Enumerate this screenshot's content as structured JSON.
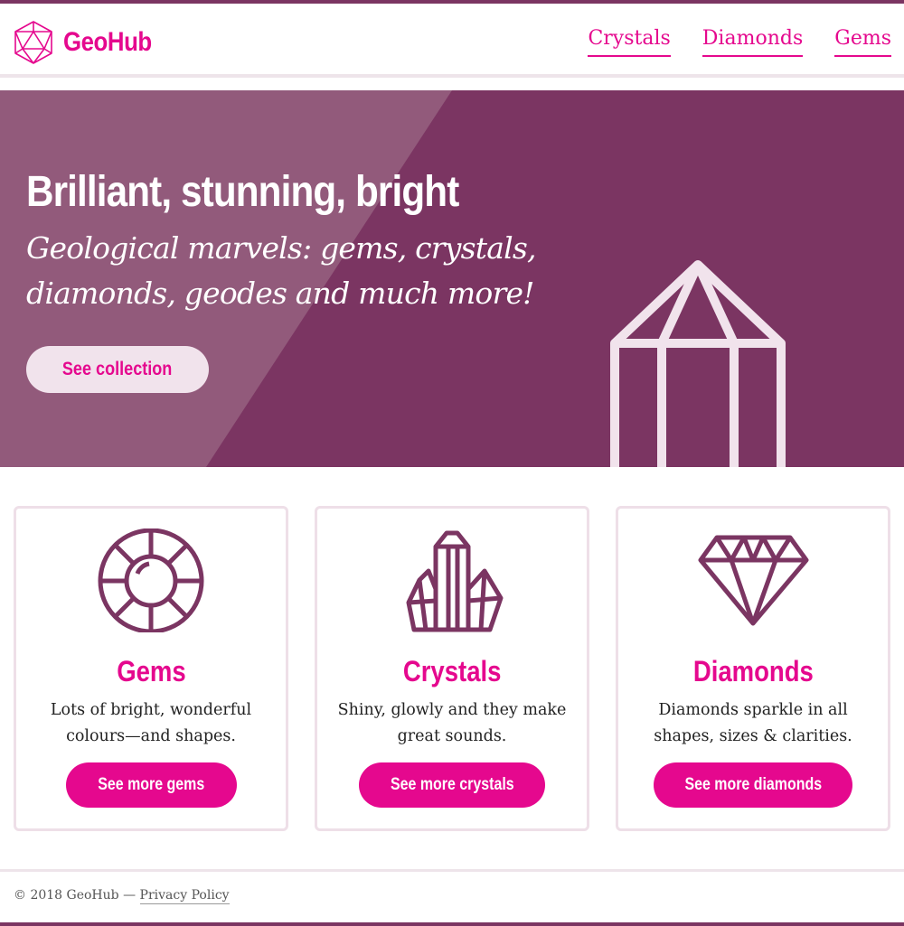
{
  "header": {
    "logo_text": "GeoHub",
    "logo_icon": "icosahedron-icon",
    "nav": [
      {
        "label": "Crystals"
      },
      {
        "label": "Diamonds"
      },
      {
        "label": "Gems"
      }
    ]
  },
  "hero": {
    "title": "Brilliant, stunning, bright",
    "subtitle": "Geological marvels: gems, crystals, diamonds, geodes and much more!",
    "button_label": "See collection",
    "illustration": "crystal-outline-icon"
  },
  "cards": [
    {
      "icon": "gem-icon",
      "title": "Gems",
      "text": "Lots of bright, wonderful colours—and shapes.",
      "button_label": "See more gems"
    },
    {
      "icon": "crystals-icon",
      "title": "Crystals",
      "text": "Shiny, glowly and they make great sounds.",
      "button_label": "See more crystals"
    },
    {
      "icon": "diamond-icon",
      "title": "Diamonds",
      "text": "Diamonds sparkle in all shapes, sizes & clarities.",
      "button_label": "See more diamonds"
    }
  ],
  "footer": {
    "copyright": "© 2018 GeoHub —",
    "privacy_label": "Privacy Policy"
  },
  "colors": {
    "accent": "#e5088e",
    "plum": "#7b3562",
    "plum_light": "#925a7b",
    "pale_pink": "#f1e3ec"
  }
}
